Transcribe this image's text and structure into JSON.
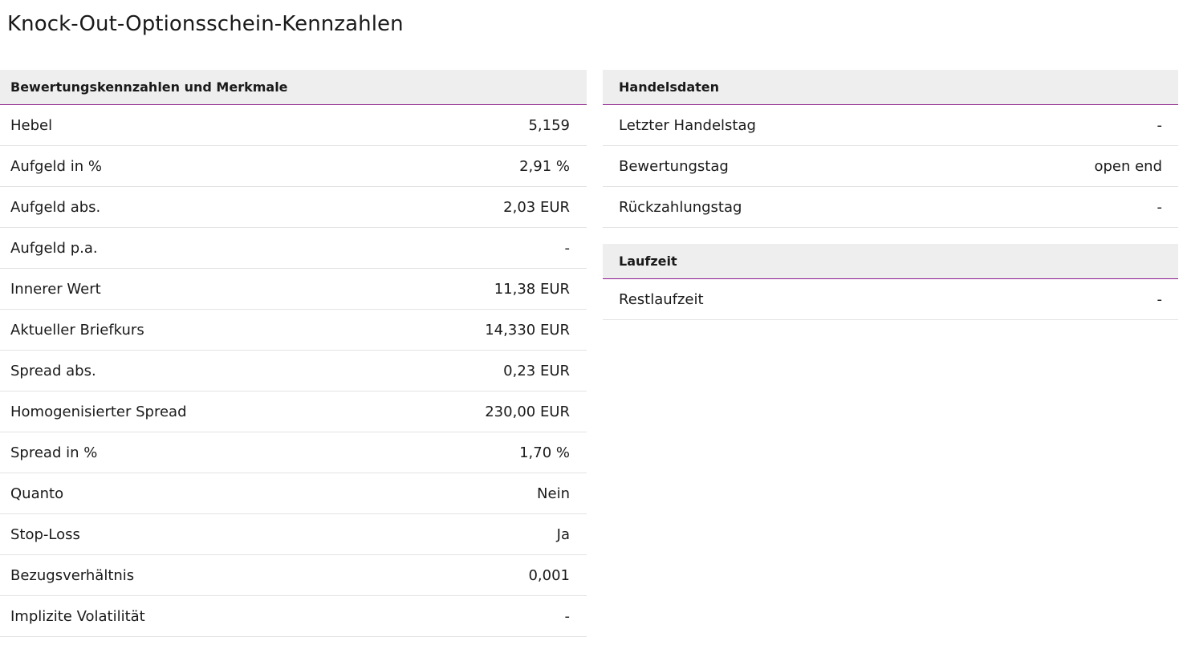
{
  "page_title": "Knock-Out-Optionsschein-Kennzahlen",
  "left_section": {
    "title": "Bewertungskennzahlen und Merkmale",
    "rows": [
      {
        "label": "Hebel",
        "value": "5,159"
      },
      {
        "label": "Aufgeld in %",
        "value": "2,91 %"
      },
      {
        "label": "Aufgeld abs.",
        "value": "2,03 EUR"
      },
      {
        "label": "Aufgeld p.a.",
        "value": "-"
      },
      {
        "label": "Innerer Wert",
        "value": "11,38 EUR"
      },
      {
        "label": "Aktueller Briefkurs",
        "value": "14,330 EUR"
      },
      {
        "label": "Spread abs.",
        "value": "0,23 EUR"
      },
      {
        "label": "Homogenisierter Spread",
        "value": "230,00 EUR"
      },
      {
        "label": "Spread in %",
        "value": "1,70 %"
      },
      {
        "label": "Quanto",
        "value": "Nein"
      },
      {
        "label": "Stop-Loss",
        "value": "Ja"
      },
      {
        "label": "Bezugsverhältnis",
        "value": "0,001"
      },
      {
        "label": "Implizite Volatilität",
        "value": "-"
      }
    ]
  },
  "handelsdaten": {
    "title": "Handelsdaten",
    "rows": [
      {
        "label": "Letzter Handelstag",
        "value": "-"
      },
      {
        "label": "Bewertungstag",
        "value": "open end"
      },
      {
        "label": "Rückzahlungstag",
        "value": "-"
      }
    ]
  },
  "laufzeit": {
    "title": "Laufzeit",
    "rows": [
      {
        "label": "Restlaufzeit",
        "value": "-"
      }
    ]
  },
  "colors": {
    "header_background": "#eeeeee",
    "accent_line": "#8a1a8a",
    "row_divider": "#e3e3e3"
  }
}
